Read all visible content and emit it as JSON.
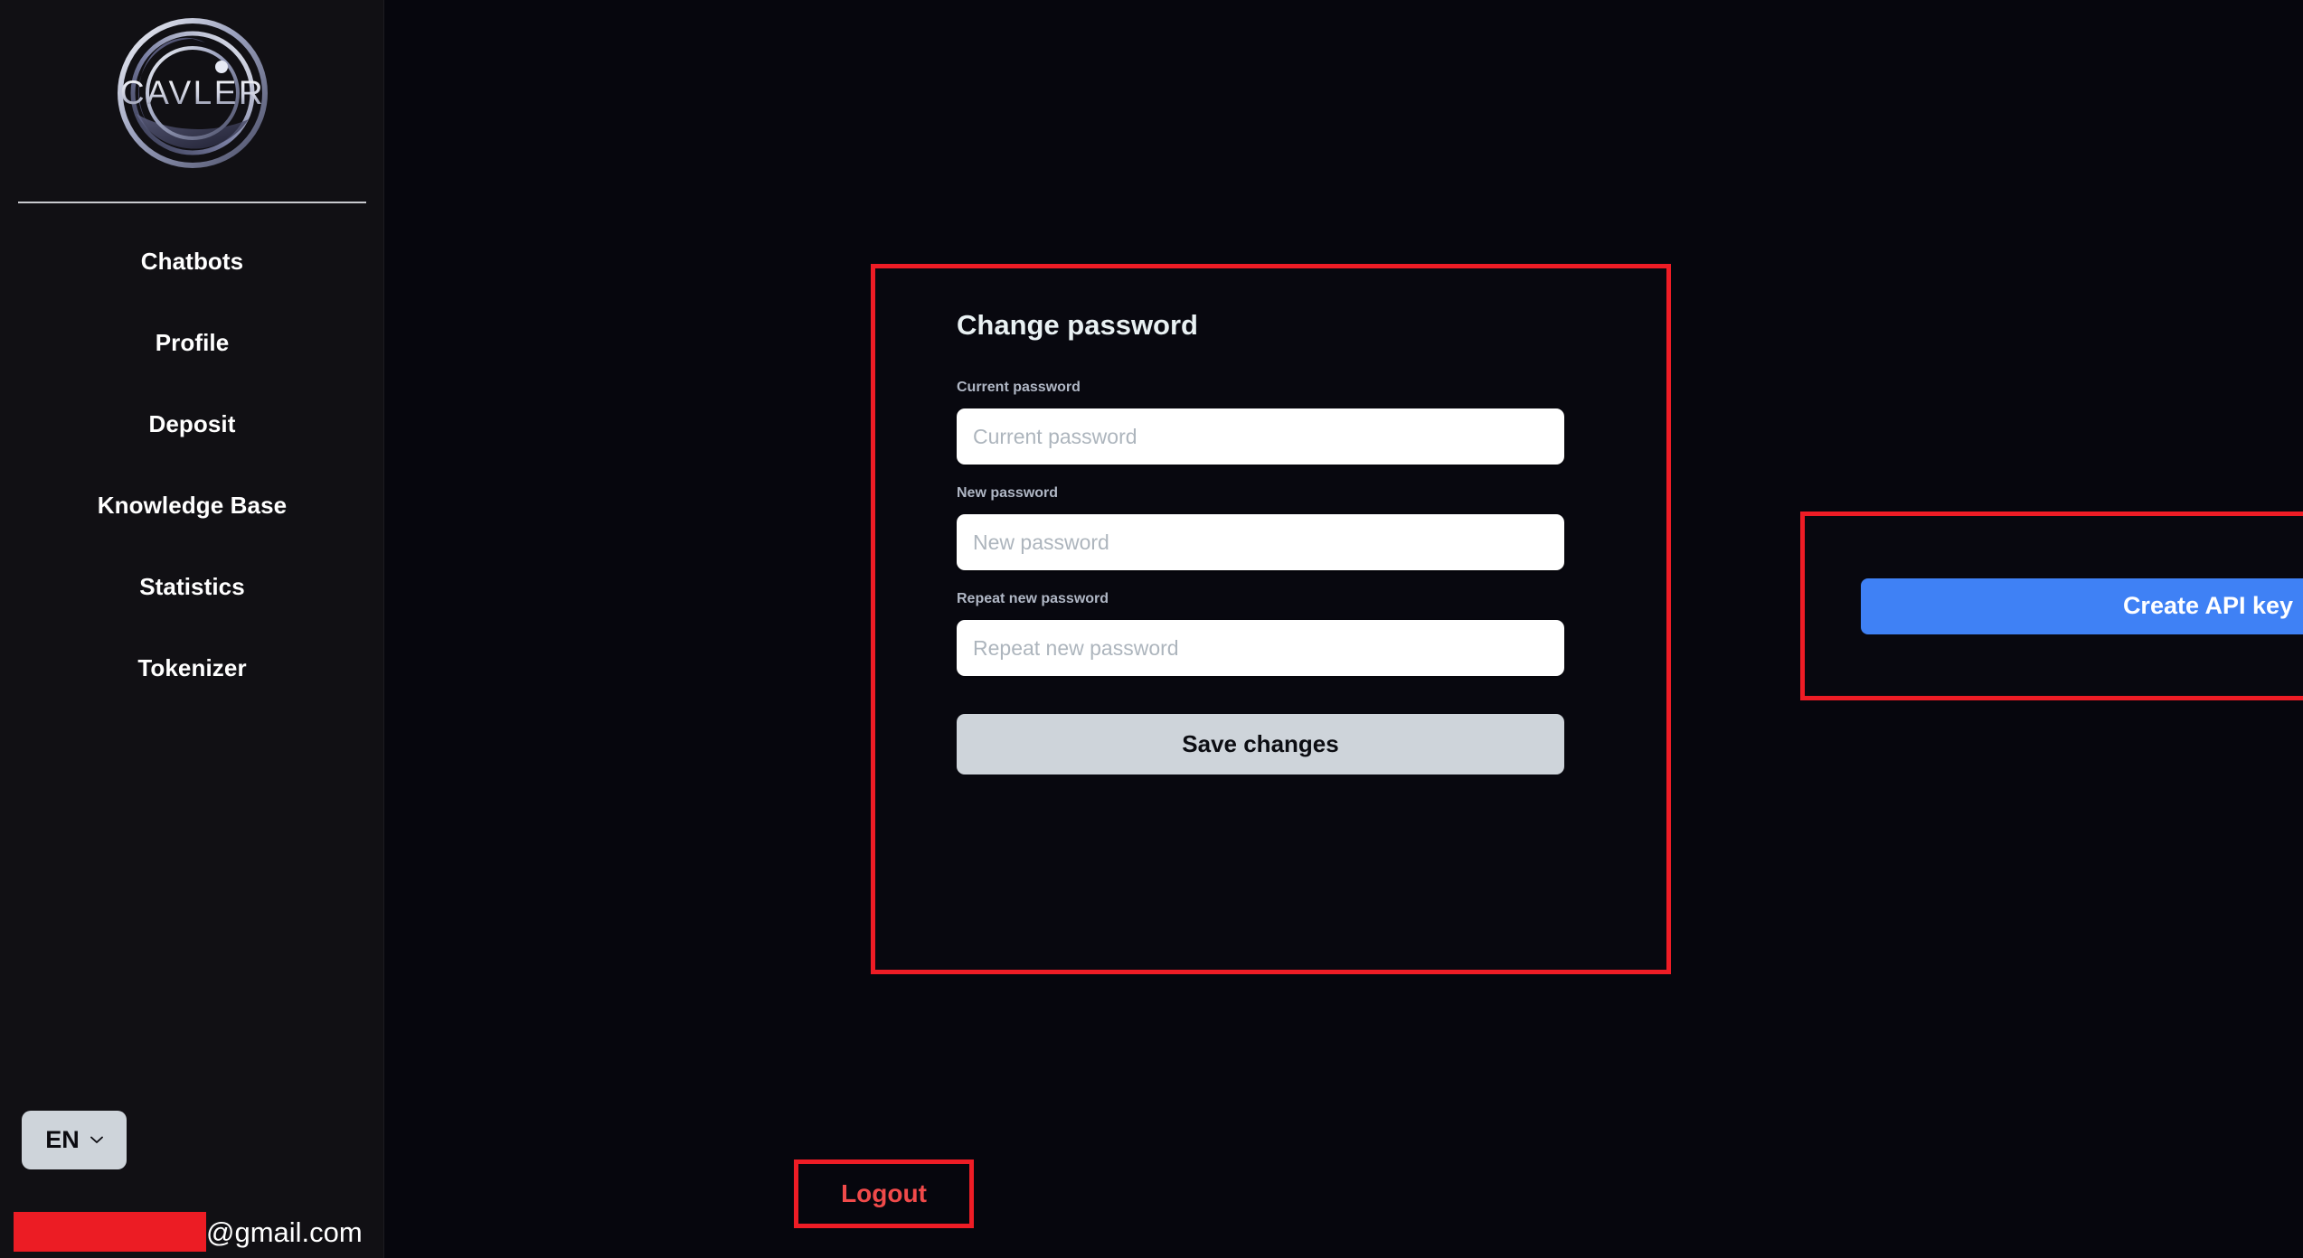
{
  "app": {
    "brand": "CAVLER",
    "background": "#06060d",
    "sidebar_background": "#111014"
  },
  "sidebar": {
    "logo_alt": "CAVLER",
    "items": [
      {
        "label": "Chatbots"
      },
      {
        "label": "Profile"
      },
      {
        "label": "Deposit"
      },
      {
        "label": "Knowledge Base"
      },
      {
        "label": "Statistics"
      },
      {
        "label": "Tokenizer"
      }
    ],
    "language": {
      "code": "EN",
      "chevron_icon": "chevron-down-icon"
    },
    "account": {
      "email_domain": "@gmail.com",
      "email_user_redacted": true,
      "redaction_color": "#ec1c24"
    }
  },
  "main": {
    "password_card": {
      "title": "Change password",
      "fields": [
        {
          "label": "Current password",
          "placeholder": "Current password",
          "value": ""
        },
        {
          "label": "New password",
          "placeholder": "New password",
          "value": ""
        },
        {
          "label": "Repeat new password",
          "placeholder": "Repeat new password",
          "value": ""
        }
      ],
      "save_label": "Save changes",
      "save_color": "#ced4da"
    },
    "api_panel": {
      "create_label": "Create API key",
      "accent_color": "#3f81f5"
    },
    "logout": {
      "label": "Logout",
      "color": "#f04a4a"
    },
    "annotations": {
      "color": "#ee1c25",
      "boxes": [
        "password-card",
        "api-key-panel",
        "logout-button"
      ]
    }
  }
}
